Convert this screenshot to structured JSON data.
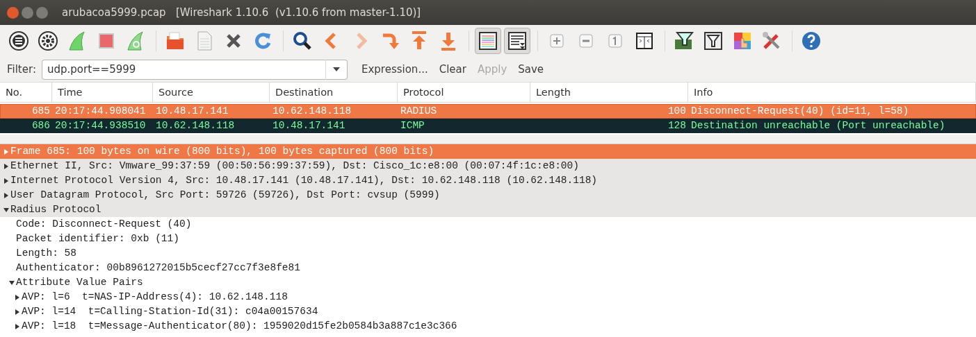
{
  "window": {
    "title": "arubacoa5999.pcap   [Wireshark 1.10.6  (v1.10.6 from master-1.10)]"
  },
  "toolbar": [
    [
      {
        "kind": "interfaces",
        "pressed": false,
        "disabled": false
      },
      {
        "kind": "options",
        "pressed": false,
        "disabled": false
      },
      {
        "kind": "start",
        "pressed": false,
        "disabled": false
      },
      {
        "kind": "stop",
        "pressed": false,
        "disabled": false
      },
      {
        "kind": "restart",
        "pressed": false,
        "disabled": false
      }
    ],
    [
      {
        "kind": "open",
        "pressed": false,
        "disabled": false
      },
      {
        "kind": "save",
        "pressed": false,
        "disabled": false
      },
      {
        "kind": "close",
        "pressed": false,
        "disabled": false
      },
      {
        "kind": "reload",
        "pressed": false,
        "disabled": false
      }
    ],
    [
      {
        "kind": "find",
        "pressed": false,
        "disabled": false
      },
      {
        "kind": "back",
        "pressed": false,
        "disabled": false
      },
      {
        "kind": "forward",
        "pressed": false,
        "disabled": true
      },
      {
        "kind": "goto",
        "pressed": false,
        "disabled": false
      },
      {
        "kind": "first",
        "pressed": false,
        "disabled": false
      },
      {
        "kind": "last",
        "pressed": false,
        "disabled": false
      }
    ],
    [
      {
        "kind": "colorize",
        "pressed": true,
        "disabled": false
      },
      {
        "kind": "autoscroll",
        "pressed": true,
        "disabled": false
      }
    ],
    [
      {
        "kind": "zoomin",
        "pressed": false,
        "disabled": false
      },
      {
        "kind": "zoomout",
        "pressed": false,
        "disabled": false
      },
      {
        "kind": "normalsize",
        "pressed": false,
        "disabled": false
      },
      {
        "kind": "resizecols",
        "pressed": false,
        "disabled": false
      }
    ],
    [
      {
        "kind": "capfilter",
        "pressed": false,
        "disabled": false
      },
      {
        "kind": "dispfilter",
        "pressed": false,
        "disabled": false
      },
      {
        "kind": "coloring",
        "pressed": false,
        "disabled": false
      },
      {
        "kind": "prefs",
        "pressed": false,
        "disabled": false
      }
    ],
    [
      {
        "kind": "help",
        "pressed": false,
        "disabled": false
      }
    ]
  ],
  "filter": {
    "label": "Filter:",
    "value": "udp.port==5999",
    "buttons": [
      {
        "label": "Expression...",
        "disabled": false
      },
      {
        "label": "Clear",
        "disabled": false
      },
      {
        "label": "Apply",
        "disabled": true
      },
      {
        "label": "Save",
        "disabled": false
      }
    ]
  },
  "packet_list": {
    "columns": [
      "No.",
      "Time",
      "Source",
      "Destination",
      "Protocol",
      "Length",
      "Info"
    ],
    "rows": [
      {
        "cells": [
          "685",
          "20:17:44.908041",
          "10.48.17.141",
          "10.62.148.118",
          "RADIUS",
          "100",
          "Disconnect-Request(40) (id=11, l=58)"
        ],
        "selected": true,
        "color": "#f07746"
      },
      {
        "cells": [
          "686",
          "20:17:44.938510",
          "10.62.148.118",
          "10.48.17.141",
          "ICMP",
          "128",
          "Destination unreachable (Port unreachable)"
        ],
        "selected": false,
        "color": "#12272e",
        "kind": "error"
      }
    ]
  },
  "details": [
    {
      "text": "Frame 685: 100 bytes on wire (800 bits), 100 bytes captured (800 bits)",
      "expanded": false,
      "selected": true
    },
    {
      "text": "Ethernet II, Src: Vmware_99:37:59 (00:50:56:99:37:59), Dst: Cisco_1c:e8:00 (00:07:4f:1c:e8:00)",
      "expanded": false,
      "selected": false
    },
    {
      "text": "Internet Protocol Version 4, Src: 10.48.17.141 (10.48.17.141), Dst: 10.62.148.118 (10.62.148.118)",
      "expanded": false,
      "selected": false
    },
    {
      "text": "User Datagram Protocol, Src Port: 59726 (59726), Dst Port: cvsup (5999)",
      "expanded": false,
      "selected": false
    },
    {
      "text": "Radius Protocol",
      "expanded": true,
      "selected": false,
      "children": [
        {
          "text": "Code: Disconnect-Request (40)",
          "selected": false
        },
        {
          "text": "Packet identifier: 0xb (11)",
          "selected": false
        },
        {
          "text": "Length: 58",
          "selected": false
        },
        {
          "text": "Authenticator: 00b8961272015b5cecf27cc7f3e8fe81",
          "selected": false
        },
        {
          "text": "Attribute Value Pairs",
          "expanded": true,
          "selected": false,
          "children": [
            {
              "text": "AVP: l=6  t=NAS-IP-Address(4): 10.62.148.118",
              "expanded": false,
              "selected": false
            },
            {
              "text": "AVP: l=14  t=Calling-Station-Id(31): c04a00157634",
              "expanded": false,
              "selected": false
            },
            {
              "text": "AVP: l=18  t=Message-Authenticator(80): 1959020d15fe2b0584b3a887c1e3c366",
              "expanded": false,
              "selected": false
            }
          ]
        }
      ]
    }
  ]
}
